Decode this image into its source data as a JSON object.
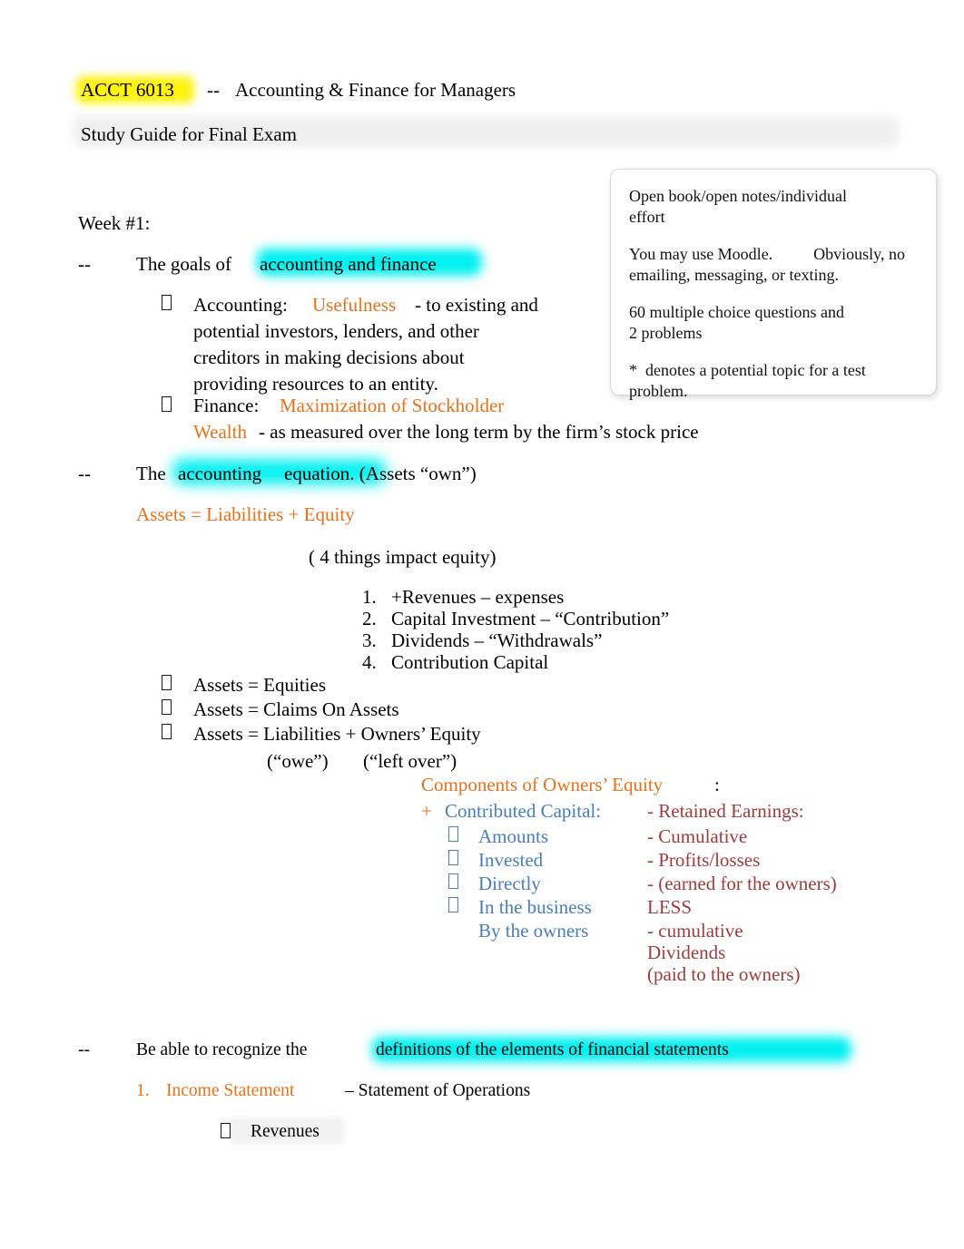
{
  "document": {
    "course_code": "ACCT 6013",
    "dash": "--",
    "course_title": "Accounting & Finance for Managers",
    "subtitle": "Study Guide for Final Exam"
  },
  "note_box": {
    "lines": [
      "Open book/open notes/individual",
      "effort",
      "You may use Moodle.          Obviously, no",
      "emailing, messaging, or texting.",
      "60 multiple choice questions and",
      "2 problems",
      "*  denotes a potential topic for a test",
      "problem."
    ]
  },
  "body": {
    "week_heading": "Week #1:",
    "goals": {
      "dash": "--",
      "lead": "The goals of",
      "highlight": "accounting and finance",
      "accounting": {
        "label": "Accounting:",
        "key_term": "Usefulness",
        "line1": "- to existing and",
        "line2": "potential investors, lenders, and other",
        "line3": "creditors in making decisions about",
        "line4": "providing resources to an entity."
      },
      "finance": {
        "label": "Finance:",
        "key_term_line1": "Maximization of Stockholder",
        "key_term_line2": "Wealth",
        "tail": "- as measured over the long term by the firm’s stock price"
      }
    },
    "equation": {
      "dash": "--",
      "lead_the": "The",
      "highlight_word": "accounting",
      "rest": "equation. (Assets “own”)",
      "formula": "Assets = Liabilities + Equity",
      "parenthetical": "( 4 things impact equity)",
      "impacts": [
        "+Revenues – expenses",
        "Capital Investment – “Contribution”",
        "Dividends – “Withdrawals”",
        "Contribution Capital"
      ],
      "identities": [
        "Assets = Equities",
        "Assets = Claims On Assets",
        "Assets = Liabilities + Owners’ Equity"
      ],
      "owe_label": "(“owe”)",
      "left_over_label": "(“left over”)"
    },
    "owners_equity": {
      "heading": "Components of Owners’ Equity",
      "heading_colon": ":",
      "plus_sign": "+",
      "contributed_capital_label": "Contributed Capital:",
      "contributed_items": [
        "Amounts",
        "Invested",
        "Directly",
        "In the business",
        "By the owners"
      ],
      "retained_label": "- Retained Earnings:",
      "retained_items": [
        "- Cumulative",
        "- Profits/losses",
        "- (earned for the owners)",
        "LESS",
        "- cumulative",
        "Dividends",
        "(paid to the owners)"
      ]
    },
    "definitions": {
      "dash": "--",
      "lead": "Be able to recognize the",
      "highlight": "definitions of the elements of financial statements",
      "item_number": "1.",
      "item_title": "Income Statement",
      "item_tail": "– Statement of Operations",
      "sub_item": "Revenues"
    }
  },
  "colors": {
    "orange": "#E8711A",
    "blue": "#4A7EBB",
    "maroon": "#9E3B3B",
    "highlight_yellow": "#FFF200",
    "highlight_cyan": "#00F0F0"
  }
}
